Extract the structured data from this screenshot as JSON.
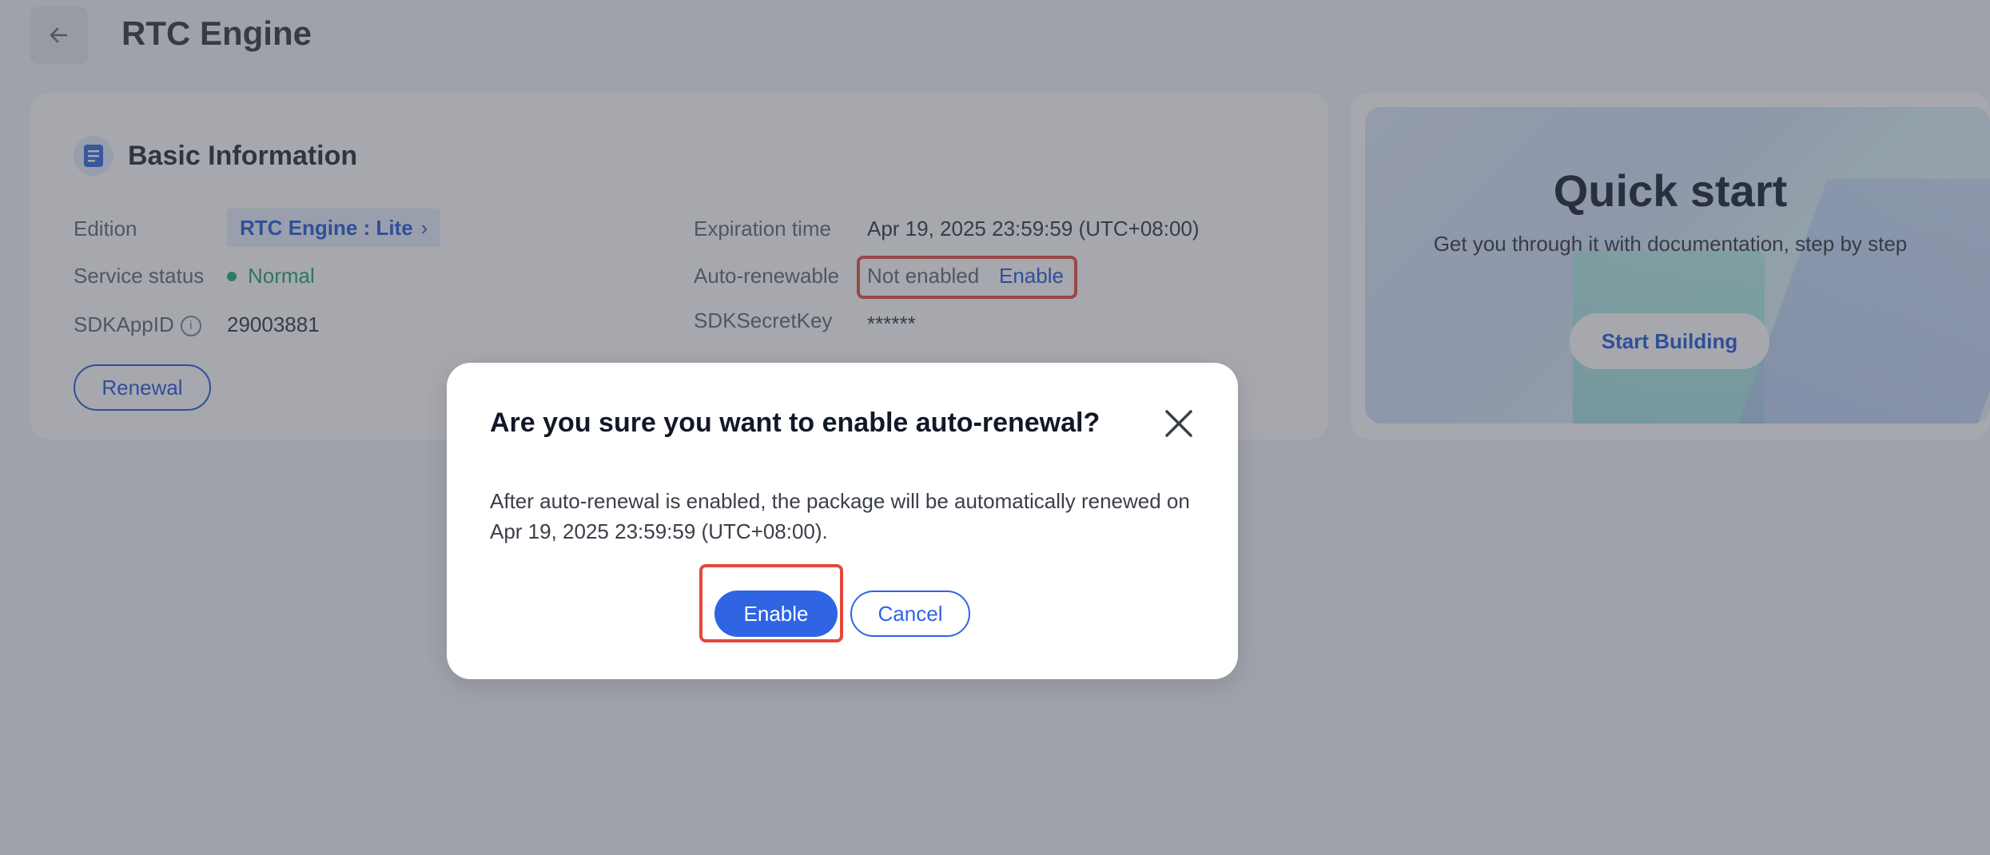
{
  "header": {
    "title": "RTC Engine",
    "back_icon": "arrow-left-icon"
  },
  "basic_info": {
    "title": "Basic Information",
    "icon": "document-icon",
    "fields": {
      "edition_label": "Edition",
      "edition_value": "RTC Engine : Lite",
      "service_status_label": "Service status",
      "service_status_value": "Normal",
      "sdkappid_label": "SDKAppID",
      "sdkappid_value": "29003881",
      "expiration_label": "Expiration time",
      "expiration_value": "Apr 19, 2025 23:59:59 (UTC+08:00)",
      "autorenew_label": "Auto-renewable",
      "autorenew_value": "Not enabled",
      "autorenew_link": "Enable",
      "sdksecretkey_label": "SDKSecretKey",
      "sdksecretkey_value": "******"
    },
    "renewal_button": "Renewal"
  },
  "quick_start": {
    "title": "Quick start",
    "subtitle": "Get you through it with documentation, step by step",
    "button": "Start Building"
  },
  "modal": {
    "title": "Are you sure you want to enable auto-renewal?",
    "body_line1": "After auto-renewal is enabled, the package will be automatically renewed on",
    "body_line2": "Apr 19, 2025 23:59:59 (UTC+08:00).",
    "enable_button": "Enable",
    "cancel_button": "Cancel",
    "close_icon": "close-icon"
  },
  "colors": {
    "primary": "#2f64e3",
    "link": "#1d54d6",
    "status_normal": "#1f9d63",
    "highlight": "#e4483a"
  }
}
